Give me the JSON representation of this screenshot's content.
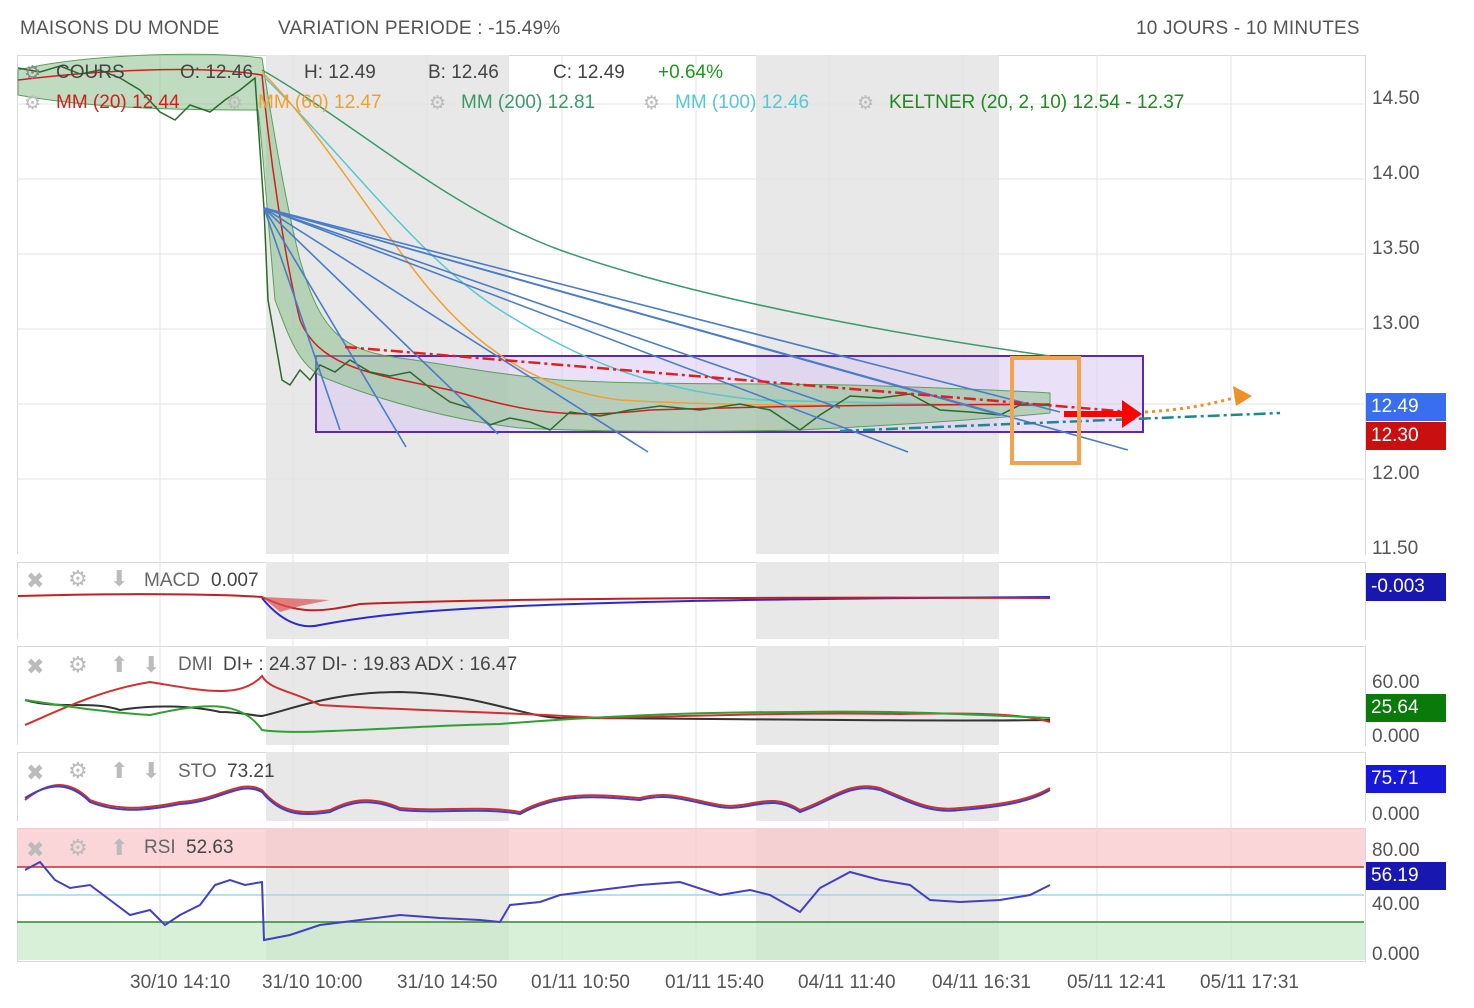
{
  "header": {
    "title": "MAISONS DU MONDE",
    "variation": "VARIATION PERIODE : -15.49%",
    "period": "10 JOURS - 10 MINUTES"
  },
  "legend": {
    "cours": "COURS",
    "open": "O: 12.46",
    "high": "H: 12.49",
    "bid": "B: 12.46",
    "close": "C: 12.49",
    "change": "+0.64%",
    "mm20": "MM (20) 12.44",
    "mm60": "MM (60) 12.47",
    "mm200": "MM (200) 12.81",
    "mm100": "MM (100) 12.46",
    "keltner": "KELTNER (20, 2, 10) 12.54 - 12.37"
  },
  "colors": {
    "mm20": "#d0201e",
    "mm60": "#f0a030",
    "mm200": "#3a9a6a",
    "mm100": "#56c8d0",
    "keltner": "#1f8a1f",
    "fan": "#4a7cc8",
    "box": "#5a2ab0",
    "price_up": "#1a9a1a",
    "price_down": "#d0201e",
    "highlight": "#f4a24e"
  },
  "price_axis": {
    "ticks": [
      "14.50",
      "14.00",
      "13.50",
      "13.00",
      "12.00",
      "11.50"
    ],
    "last_price": "12.49",
    "ref_price": "12.30"
  },
  "indicators": {
    "macd": {
      "name": "MACD",
      "value": "0.007",
      "pill": "-0.003"
    },
    "dmi": {
      "name": "DMI",
      "value": "DI+ : 24.37 DI- : 19.83 ADX : 16.47",
      "pill": "25.64",
      "ticks": [
        "60.00",
        "0.000"
      ]
    },
    "sto": {
      "name": "STO",
      "value": "73.21",
      "pill": "75.71",
      "ticks": [
        "0.000"
      ]
    },
    "rsi": {
      "name": "RSI",
      "value": "52.63",
      "pill": "56.19",
      "ticks": [
        "80.00",
        "40.00",
        "0.000"
      ]
    }
  },
  "x_axis": [
    "30/10 14:10",
    "31/10 10:00",
    "31/10 14:50",
    "01/11 10:50",
    "01/11 15:40",
    "04/11 11:40",
    "04/11 16:31",
    "05/11 12:41",
    "05/11 17:31"
  ],
  "chart_data": {
    "type": "line",
    "title": "MAISONS DU MONDE",
    "categories": [
      "30/10 14:10",
      "31/10 10:00",
      "31/10 14:50",
      "01/11 10:50",
      "01/11 15:40",
      "04/11 11:40",
      "04/11 16:31"
    ],
    "series": [
      {
        "name": "COURS",
        "values": [
          14.42,
          12.55,
          12.35,
          12.42,
          12.45,
          12.38,
          12.49
        ]
      }
    ],
    "ylim": [
      11.5,
      14.8
    ],
    "last": 12.49,
    "open": 12.46,
    "high": 12.49,
    "low_bid": 12.46,
    "close": 12.49,
    "change_pct": 0.64,
    "variation_period_pct": -15.49
  }
}
